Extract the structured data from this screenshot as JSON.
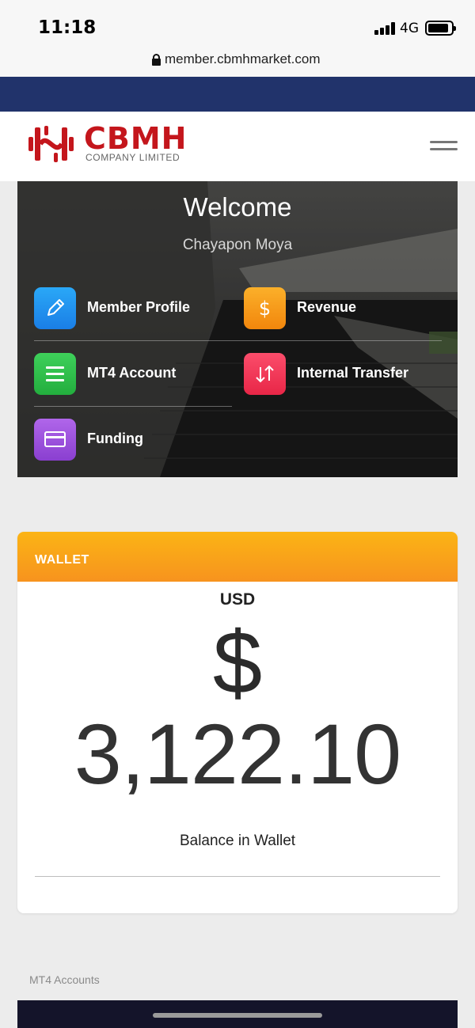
{
  "status_bar": {
    "time": "11:18",
    "network": "4G"
  },
  "browser": {
    "url": "member.cbmhmarket.com"
  },
  "header": {
    "logo_name": "CBMH",
    "logo_subtitle": "COMPANY LIMITED"
  },
  "hero": {
    "title": "Welcome",
    "user_name": "Chayapon Moya",
    "menu": [
      {
        "label": "Member Profile",
        "icon": "pencil-icon",
        "color": "#1e8ff0"
      },
      {
        "label": "Revenue",
        "icon": "dollar-icon",
        "color": "#f79a1a"
      },
      {
        "label": "MT4 Account",
        "icon": "list-icon",
        "color": "#2ebf4a"
      },
      {
        "label": "Internal Transfer",
        "icon": "transfer-arrows-icon",
        "color": "#f0355a"
      },
      {
        "label": "Funding",
        "icon": "card-icon",
        "color": "#9b4fd8"
      }
    ]
  },
  "wallet": {
    "title": "WALLET",
    "currency": "USD",
    "symbol": "$",
    "amount": "3,122.10",
    "caption": "Balance in Wallet",
    "header_color": "#f9a51a"
  },
  "mt4_section": {
    "title": "MT4 Accounts"
  }
}
